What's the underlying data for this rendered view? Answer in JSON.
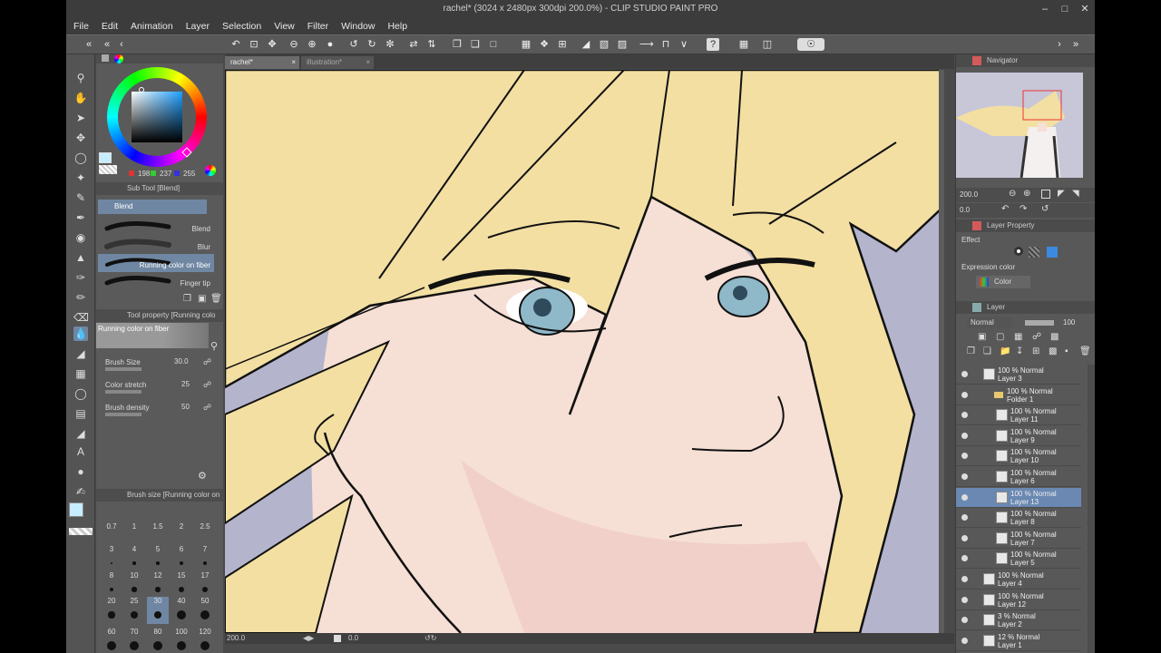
{
  "window": {
    "title": "rachel* (3024 x 2480px 300dpi 200.0%) - CLIP STUDIO PAINT PRO"
  },
  "menu": [
    "File",
    "Edit",
    "Animation",
    "Layer",
    "Selection",
    "View",
    "Filter",
    "Window",
    "Help"
  ],
  "tabs": [
    {
      "label": "rachel*",
      "active": true
    },
    {
      "label": "illustration*",
      "active": false
    }
  ],
  "color_wheel": {
    "r": "198",
    "g": "237",
    "b": "255",
    "main_color": "#c6edff",
    "sub_color": "#ffffff"
  },
  "sub_tool": {
    "title": "Sub Tool [Blend]",
    "group": "Blend",
    "items": [
      "Blend",
      "Blur",
      "Running color on fiber",
      "Finger tip"
    ],
    "selected": "Running color on fiber"
  },
  "tool_property": {
    "title": "Tool property [Running colo",
    "tool_name": "Running color on fiber",
    "props": [
      {
        "label": "Brush Size",
        "value": "30.0"
      },
      {
        "label": "Color stretch",
        "value": "25"
      },
      {
        "label": "Brush density",
        "value": "50"
      }
    ]
  },
  "brush_size": {
    "title": "Brush size [Running color on",
    "rows": [
      [
        "0.7",
        "1",
        "1.5",
        "2",
        "2.5"
      ],
      [
        "3",
        "4",
        "5",
        "6",
        "7"
      ],
      [
        "8",
        "10",
        "12",
        "15",
        "17"
      ],
      [
        "20",
        "25",
        "30",
        "40",
        "50"
      ],
      [
        "60",
        "70",
        "80",
        "100",
        "120"
      ]
    ],
    "selected": "30"
  },
  "navigator": {
    "title": "Navigator",
    "zoom": "200.0",
    "angle": "0.0"
  },
  "layer_property": {
    "title": "Layer Property",
    "effect_label": "Effect",
    "expression_label": "Expression color",
    "expression_value": "Color"
  },
  "layer_panel": {
    "title": "Layer",
    "blend_mode": "Normal",
    "opacity": "100",
    "layers": [
      {
        "line1": "100 % Normal",
        "line2": "Layer 3",
        "indent": 0,
        "selected": false
      },
      {
        "line1": "100 % Normal",
        "line2": "Folder 1",
        "indent": 1,
        "selected": false,
        "folder": true
      },
      {
        "line1": "100 % Normal",
        "line2": "Layer 11",
        "indent": 2,
        "selected": false
      },
      {
        "line1": "100 % Normal",
        "line2": "Layer 9",
        "indent": 2,
        "selected": false
      },
      {
        "line1": "100 % Normal",
        "line2": "Layer 10",
        "indent": 2,
        "selected": false
      },
      {
        "line1": "100 % Normal",
        "line2": "Layer 6",
        "indent": 2,
        "selected": false
      },
      {
        "line1": "100 % Normal",
        "line2": "Layer 13",
        "indent": 2,
        "selected": true
      },
      {
        "line1": "100 % Normal",
        "line2": "Layer 8",
        "indent": 2,
        "selected": false
      },
      {
        "line1": "100 % Normal",
        "line2": "Layer 7",
        "indent": 2,
        "selected": false
      },
      {
        "line1": "100 % Normal",
        "line2": "Layer 5",
        "indent": 2,
        "selected": false
      },
      {
        "line1": "100 % Normal",
        "line2": "Layer 4",
        "indent": 0,
        "selected": false
      },
      {
        "line1": "100 % Normal",
        "line2": "Layer 12",
        "indent": 0,
        "selected": false
      },
      {
        "line1": "3 % Normal",
        "line2": "Layer 2",
        "indent": 0,
        "selected": false
      },
      {
        "line1": "12 % Normal",
        "line2": "Layer 1",
        "indent": 0,
        "selected": false
      }
    ]
  },
  "status": {
    "zoom": "200.0",
    "angle": "0.0"
  },
  "colors": {
    "hair": "#f3dfa2",
    "skin": "#f6dfd4",
    "background": "#b4b4cc",
    "iris": "#8fb8c8",
    "accent_selection": "#6a88b2"
  }
}
